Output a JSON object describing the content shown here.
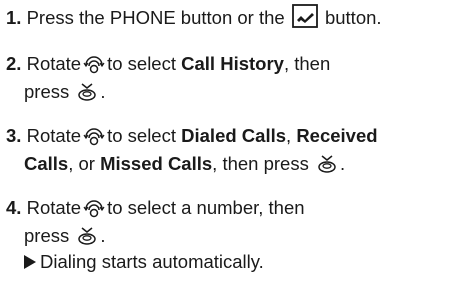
{
  "steps": [
    {
      "number": "1.",
      "text_a": "Press the PHONE button or the",
      "text_b": "button.",
      "icon": "phone-handset-icon"
    },
    {
      "number": "2.",
      "rotate": "Rotate",
      "to_select": "to select",
      "bold_1": "Call History",
      "then": ", then",
      "press": "press",
      "end": ".",
      "icons": [
        "selector-knob-icon",
        "press-down-icon"
      ]
    },
    {
      "number": "3.",
      "rotate": "Rotate",
      "to_select": "to select",
      "bold_1": "Dialed Calls",
      "sep_1": ",",
      "bold_2": "Received",
      "bold_3": "Calls",
      "sep_2": ", or",
      "bold_4": "Missed Calls",
      "then_press": ", then press",
      "end": ".",
      "icons": [
        "selector-knob-icon",
        "press-down-icon"
      ]
    },
    {
      "number": "4.",
      "rotate": "Rotate",
      "to_select": "to select a number, then",
      "press": "press",
      "end": ".",
      "icons": [
        "selector-knob-icon",
        "press-down-icon"
      ]
    }
  ],
  "result": {
    "icon": "result-triangle-icon",
    "text": "Dialing starts automatically."
  }
}
